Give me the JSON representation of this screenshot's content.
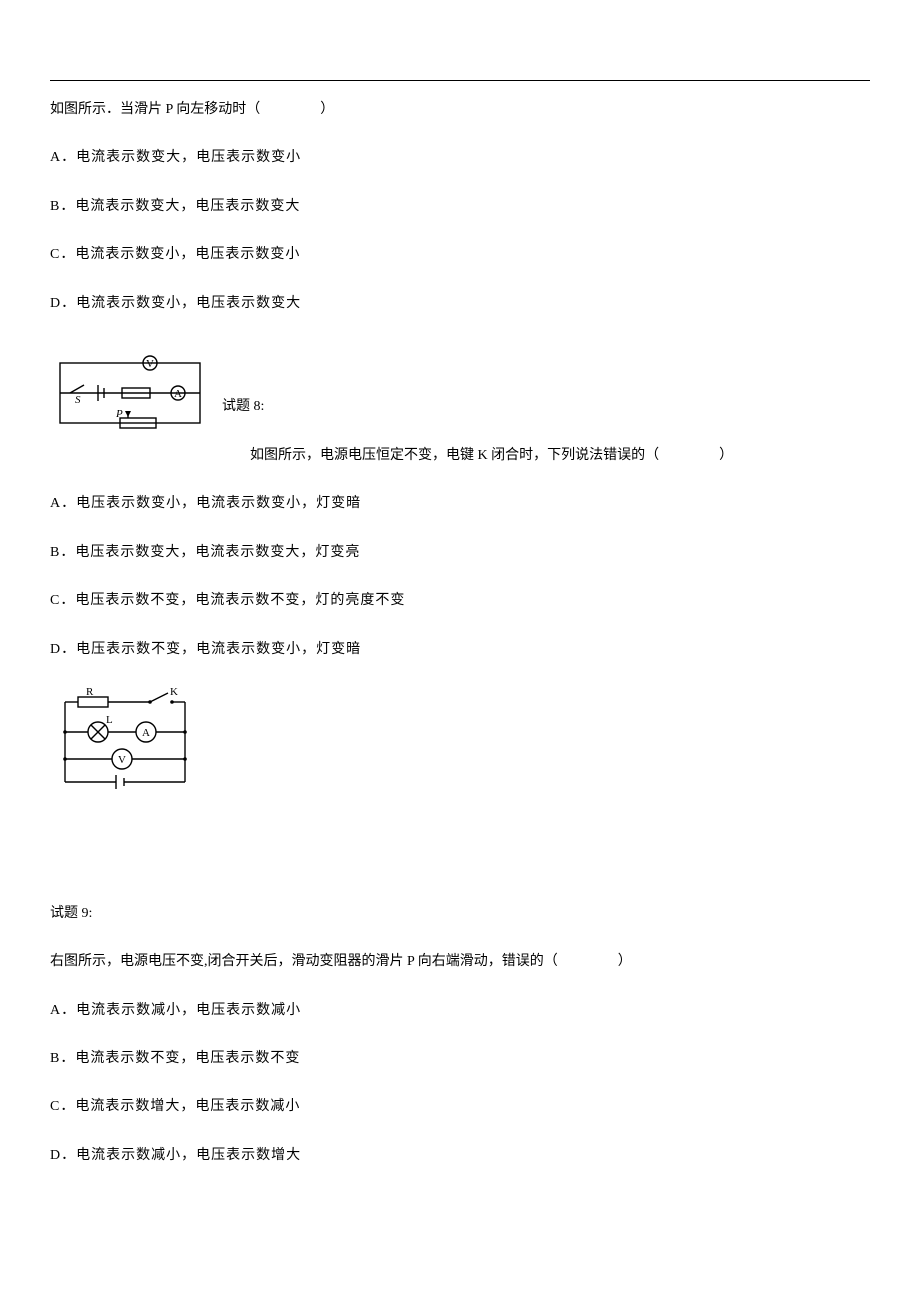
{
  "q7": {
    "stem": "如图所示．当滑片 P 向左移动时（",
    "stem_close": "）",
    "opts": {
      "A": "A．电流表示数变大，电压表示数变小",
      "B": "B．电流表示数变大，电压表示数变大",
      "C": "C．电流表示数变小，电压表示数变小",
      "D": "D．电流表示数变小，电压表示数变大"
    },
    "diagram_labels": {
      "V": "V",
      "A": "A",
      "S": "S",
      "P": "P"
    }
  },
  "q8": {
    "title": "试题 8:",
    "stem": "如图所示，电源电压恒定不变，电键 K 闭合时，下列说法错误的（",
    "stem_close": "）",
    "opts": {
      "A": "A．电压表示数变小，电流表示数变小，灯变暗",
      "B": "B．电压表示数变大，电流表示数变大，灯变亮",
      "C": "C．电压表示数不变，电流表示数不变，灯的亮度不变",
      "D": "D．电压表示数不变，电流表示数变小，灯变暗"
    },
    "diagram_labels": {
      "R": "R",
      "K": "K",
      "L": "L",
      "A": "A",
      "V": "V"
    }
  },
  "q9": {
    "title": "试题 9:",
    "stem": "右图所示，电源电压不变,闭合开关后，滑动变阻器的滑片 P 向右端滑动，错误的（",
    "stem_close": "）",
    "opts": {
      "A": "A．电流表示数减小，电压表示数减小",
      "B": "B．电流表示数不变，电压表示数不变",
      "C": "C．电流表示数增大，电压表示数减小",
      "D": "D．电流表示数减小，电压表示数增大"
    }
  }
}
